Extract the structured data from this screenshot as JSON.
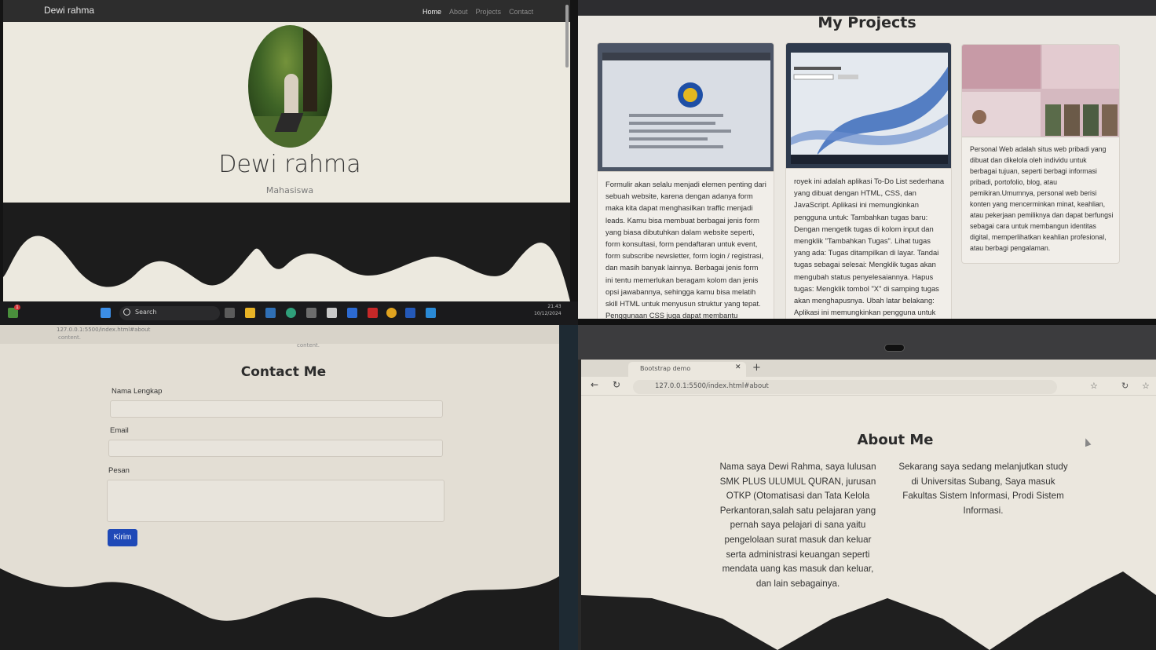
{
  "hero": {
    "brand": "Dewi rahma",
    "nav": [
      "Home",
      "About",
      "Projects",
      "Contact"
    ],
    "active_nav": "Home",
    "name": "Dewi rahma",
    "role": "Mahasiswa"
  },
  "taskbar": {
    "search_label": "Search",
    "time": "21.43",
    "date": "10/12/2024",
    "notification_count": "1"
  },
  "projects": {
    "title": "My Projects",
    "cards": [
      {
        "text": "Formulir akan selalu menjadi elemen penting dari sebuah website, karena dengan adanya form maka kita dapat menghasilkan traffic menjadi leads. Kamu bisa membuat berbagai jenis form yang biasa dibutuhkan dalam website seperti, form konsultasi, form pendaftaran untuk event, form subscribe newsletter, form login / registrasi, dan masih banyak lainnya. Berbagai jenis form ini tentu memerlukan beragam kolom dan jenis opsi jawabannya, sehingga kamu bisa melatih skill HTML untuk menyusun struktur yang tepat. Penggunaan CSS juga dapat membantu"
      },
      {
        "text": "royek ini adalah aplikasi To-Do List sederhana yang dibuat dengan HTML, CSS, dan JavaScript. Aplikasi ini memungkinkan pengguna untuk: Tambahkan tugas baru: Dengan mengetik tugas di kolom input dan mengklik \"Tambahkan Tugas\". Lihat tugas yang ada: Tugas ditampilkan di layar. Tandai tugas sebagai selesai: Mengklik tugas akan mengubah status penyelesaiannya. Hapus tugas: Mengklik tombol \"X\" di samping tugas akan menghapusnya. Ubah latar belakang: Aplikasi ini memungkinkan pengguna untuk memilih dari berbagai gambar latar belakang"
      },
      {
        "text": "Personal Web adalah situs web pribadi yang dibuat dan dikelola oleh individu untuk berbagai tujuan, seperti berbagi informasi pribadi, portofolio, blog, atau pemikiran.Umumnya, personal web berisi konten yang mencerminkan minat, keahlian, atau pekerjaan pemiliknya dan dapat berfungsi sebagai cara untuk membangun identitas digital, memperlihatkan keahlian profesional, atau berbagi pengalaman."
      }
    ]
  },
  "contact": {
    "url": "127.0.0.1:5500/index.html#about",
    "residual": "content.",
    "title": "Contact Me",
    "fields": [
      {
        "label": "Nama Lengkap"
      },
      {
        "label": "Email"
      },
      {
        "label": "Pesan"
      }
    ],
    "submit": "Kirim"
  },
  "about": {
    "tab_title": "Bootstrap demo",
    "url": "127.0.0.1:5500/index.html#about",
    "title": "About Me",
    "left": "Nama saya Dewi Rahma, saya lulusan SMK PLUS ULUMUL QURAN, jurusan OTKP (Otomatisasi dan Tata Kelola Perkantoran,salah satu pelajaran yang pernah saya pelajari di sana yaitu pengelolaan surat masuk dan keluar serta administrasi keuangan seperti mendata uang kas masuk dan keluar, dan lain sebagainya.",
    "right": "Sekarang saya sedang melanjutkan study di Universitas Subang, Saya masuk Fakultas Sistem Informasi, Prodi Sistem Informasi."
  },
  "colors": {
    "primary_button": "#1f49b7",
    "navbar": "#2d2d2d",
    "wave": "#1c1c1c"
  }
}
